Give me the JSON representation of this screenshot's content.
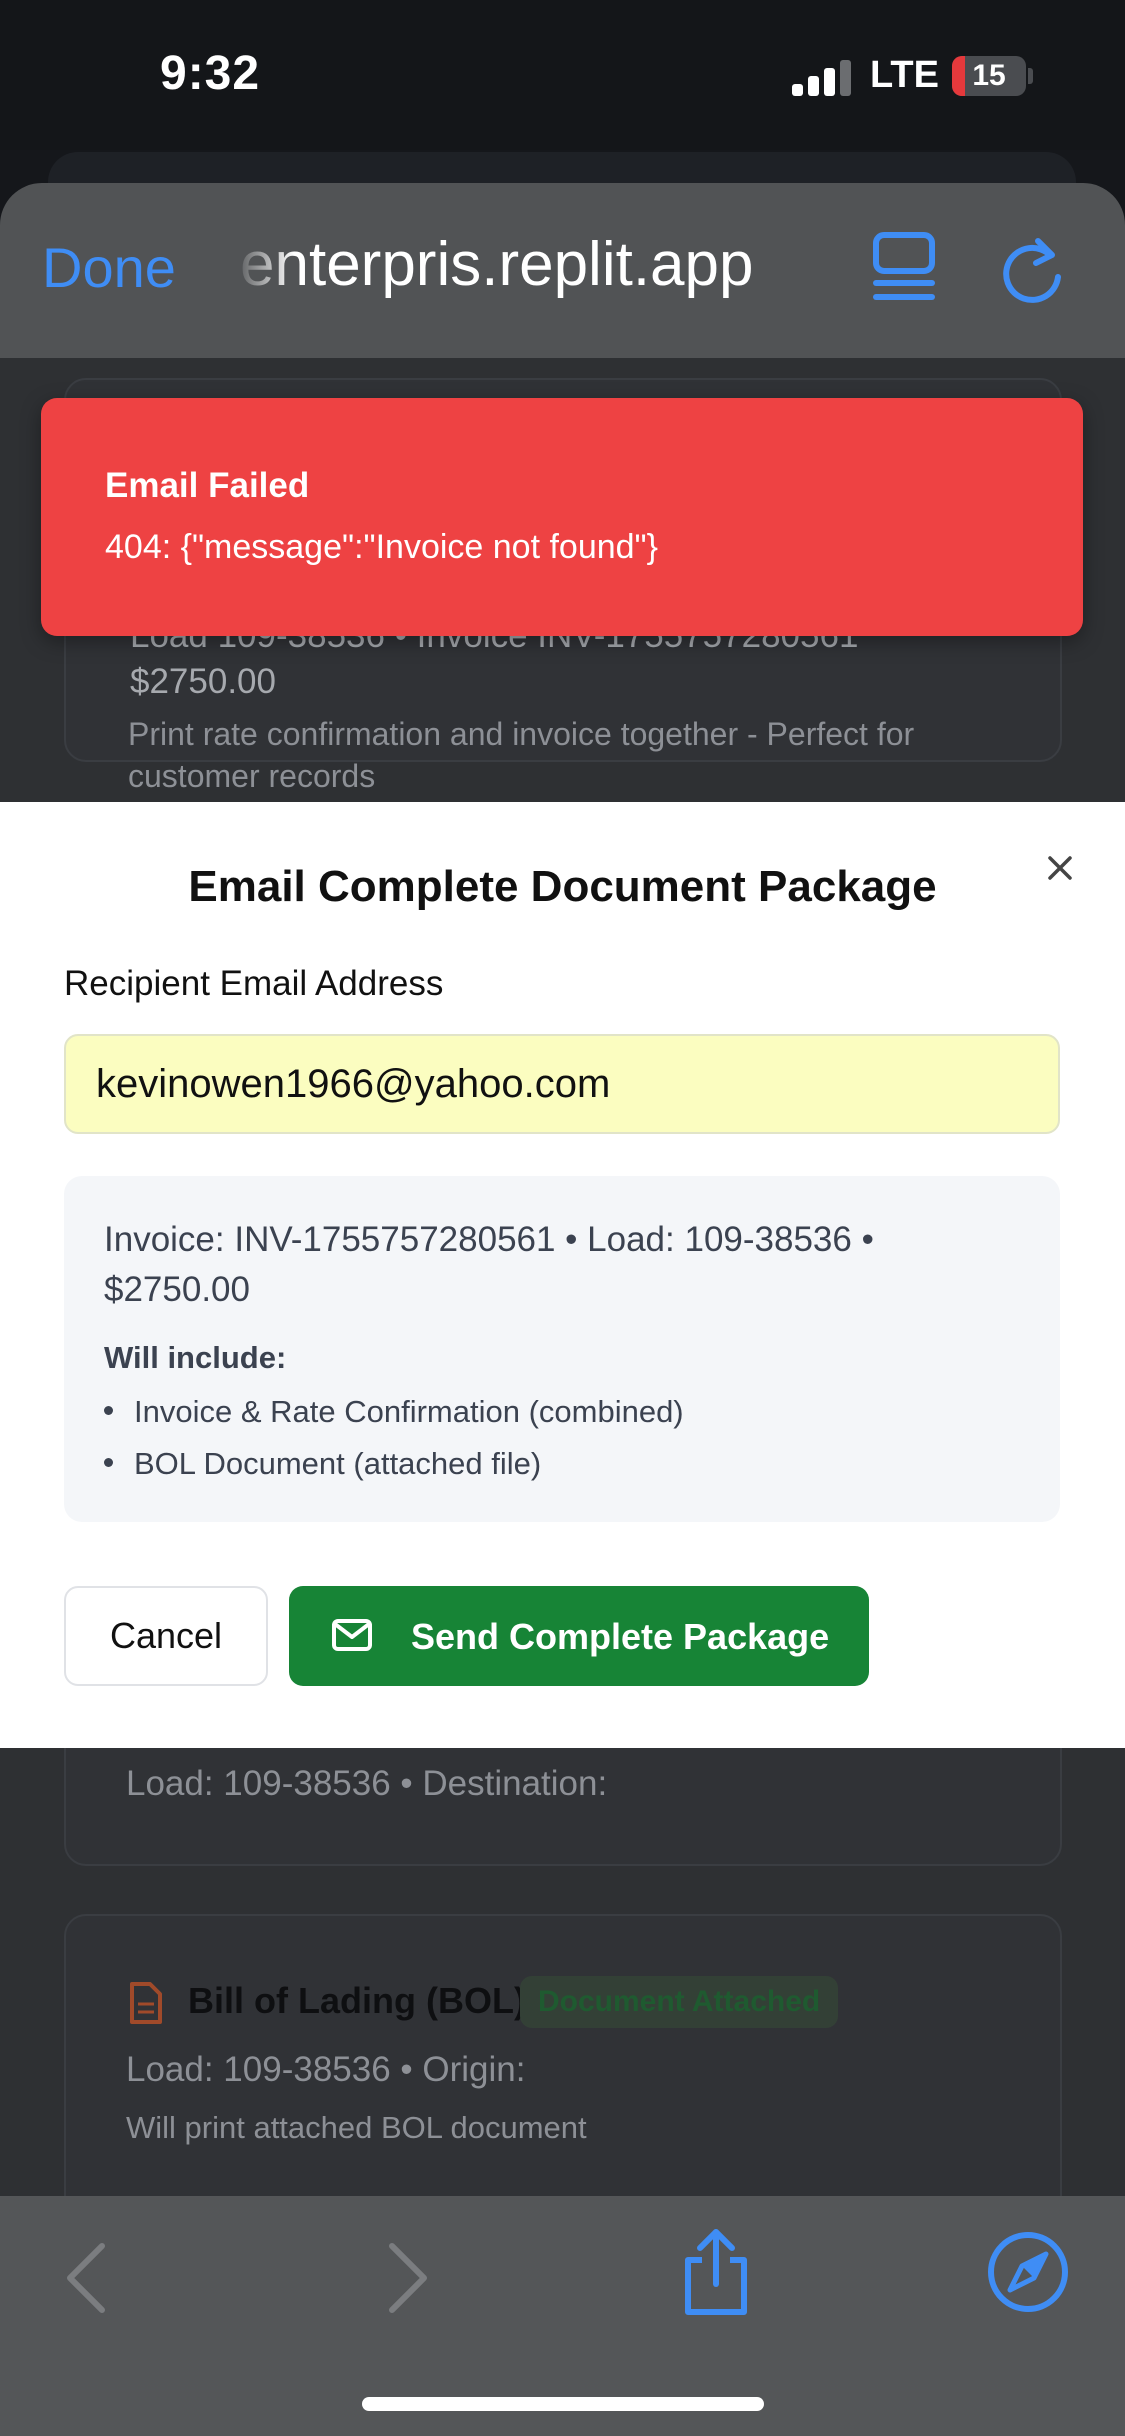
{
  "status_bar": {
    "time": "9:32",
    "network": "LTE",
    "battery": "15",
    "battery_level": 0.15
  },
  "browser": {
    "done_label": "Done",
    "url": "enterpris.replit.app",
    "icons": [
      "tabs-icon",
      "reload-icon"
    ]
  },
  "background": {
    "card1_line1": "Load 109-38536 • Invoice INV-1755757280561",
    "card1_amount": "$2750.00",
    "card1_desc_1": "Print rate confirmation and invoice together - Perfect for",
    "card1_desc_2": "customer records",
    "card2_line": "Load: 109-38536 • Destination:",
    "bol_title": "Bill of Lading (BOL)",
    "bol_badge": "Document Attached",
    "bol_line": "Load: 109-38536 • Origin:",
    "bol_desc": "Will print attached BOL document"
  },
  "toast": {
    "title": "Email Failed",
    "description": "404: {\"message\":\"Invoice not found\"}",
    "color": "#ee4243"
  },
  "modal": {
    "title": "Email Complete Document Package",
    "email_label": "Recipient Email Address",
    "email_value": "kevinowen1966@yahoo.com",
    "summary_line1": "Invoice: INV-1755757280561 • Load: 109-38536 •",
    "summary_line2": "$2750.00",
    "include_label": "Will include:",
    "include_items": [
      "Invoice & Rate Confirmation (combined)",
      "BOL Document (attached file)"
    ],
    "cancel_label": "Cancel",
    "send_label": "Send Complete Package",
    "send_color": "#178436"
  },
  "toolbar": {
    "icons": [
      "back-icon",
      "forward-icon",
      "share-icon",
      "compass-icon"
    ]
  }
}
